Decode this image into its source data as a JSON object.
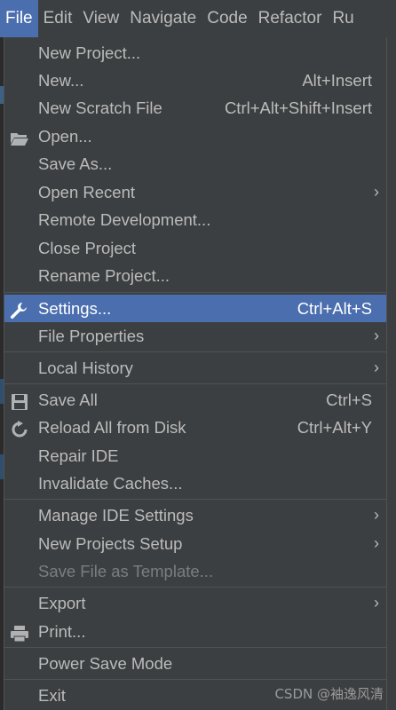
{
  "menubar": {
    "items": [
      {
        "label": "File",
        "active": true
      },
      {
        "label": "Edit"
      },
      {
        "label": "View"
      },
      {
        "label": "Navigate"
      },
      {
        "label": "Code"
      },
      {
        "label": "Refactor"
      },
      {
        "label": "Ru"
      }
    ]
  },
  "menu": {
    "items": [
      {
        "label": "New Project..."
      },
      {
        "label": "New...",
        "shortcut": "Alt+Insert"
      },
      {
        "label": "New Scratch File",
        "shortcut": "Ctrl+Alt+Shift+Insert"
      },
      {
        "label": "Open...",
        "icon": "folder-open-icon"
      },
      {
        "label": "Save As..."
      },
      {
        "label": "Open Recent",
        "submenu": true
      },
      {
        "label": "Remote Development..."
      },
      {
        "label": "Close Project"
      },
      {
        "label": "Rename Project..."
      },
      {
        "label": "Settings...",
        "shortcut": "Ctrl+Alt+S",
        "icon": "wrench-icon",
        "selected": true
      },
      {
        "label": "File Properties",
        "submenu": true
      },
      {
        "label": "Local History",
        "submenu": true
      },
      {
        "label": "Save All",
        "shortcut": "Ctrl+S",
        "icon": "save-icon"
      },
      {
        "label": "Reload All from Disk",
        "shortcut": "Ctrl+Alt+Y",
        "icon": "reload-icon"
      },
      {
        "label": "Repair IDE"
      },
      {
        "label": "Invalidate Caches..."
      },
      {
        "label": "Manage IDE Settings",
        "submenu": true
      },
      {
        "label": "New Projects Setup",
        "submenu": true
      },
      {
        "label": "Save File as Template...",
        "disabled": true
      },
      {
        "label": "Export",
        "submenu": true
      },
      {
        "label": "Print...",
        "icon": "print-icon"
      },
      {
        "label": "Power Save Mode"
      },
      {
        "label": "Exit"
      }
    ],
    "submenu_glyph": "›"
  },
  "colors": {
    "background": "#3c3f41",
    "selection": "#4b6eaf",
    "text": "#bbbbbb",
    "disabled_text": "#7b7e80",
    "separator": "#515151"
  },
  "watermark": "CSDN @袖逸风清"
}
